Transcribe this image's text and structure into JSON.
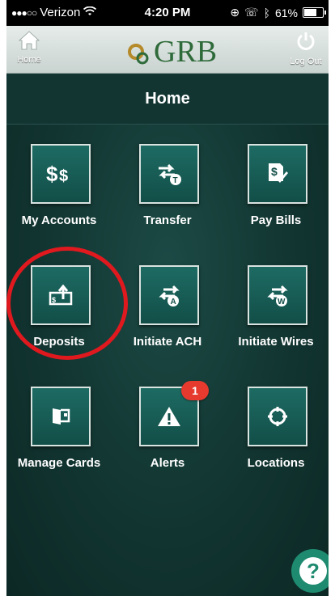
{
  "status_bar": {
    "carrier": "Verizon",
    "time": "4:20 PM",
    "battery": "61%",
    "battery_level": 0.61
  },
  "nav": {
    "home_label": "Home",
    "logo_text": "GRB",
    "logout_label": "Log Out"
  },
  "page": {
    "title": "Home"
  },
  "tiles": [
    {
      "label": "My Accounts",
      "icon": "dollar-icon"
    },
    {
      "label": "Transfer",
      "icon": "transfer-icon"
    },
    {
      "label": "Pay Bills",
      "icon": "pay-bills-icon"
    },
    {
      "label": "Deposits",
      "icon": "deposit-icon"
    },
    {
      "label": "Initiate ACH",
      "icon": "ach-icon"
    },
    {
      "label": "Initiate Wires",
      "icon": "wire-icon"
    },
    {
      "label": "Manage Cards",
      "icon": "card-icon"
    },
    {
      "label": "Alerts",
      "icon": "alert-icon",
      "badge": "1"
    },
    {
      "label": "Locations",
      "icon": "location-icon"
    }
  ],
  "colors": {
    "accent": "#1e8a6f",
    "highlight_circle": "#e0191f",
    "badge": "#e63a2f"
  }
}
